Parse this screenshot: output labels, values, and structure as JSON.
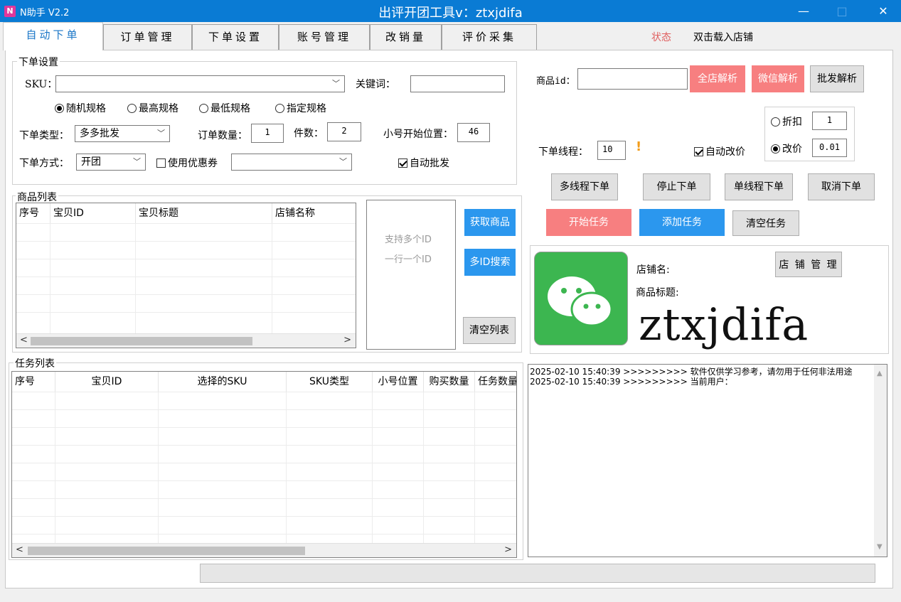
{
  "titlebar": {
    "app_name": "N助手 V2.2",
    "title": "出评开团工具v：ztxjdifa",
    "minimize": "—",
    "maximize": "□",
    "close": "✕"
  },
  "tabs": [
    "自动下单",
    "订单管理",
    "下单设置",
    "账号管理",
    "改销量",
    "评价采集"
  ],
  "status": {
    "label": "状态",
    "load_store": "双击载入店铺"
  },
  "order_settings": {
    "title": "下单设置",
    "sku_label": "SKU：",
    "sku_value": "",
    "keyword_label": "关键词：",
    "keyword_value": "",
    "spec_options": [
      "随机规格",
      "最高规格",
      "最低规格",
      "指定规格"
    ],
    "spec_selected": 0,
    "order_type_label": "下单类型：",
    "order_type_value": "多多批发",
    "order_qty_label": "订单数量：",
    "order_qty_value": "1",
    "pieces_label": "件数：",
    "pieces_value": "2",
    "start_pos_label": "小号开始位置：",
    "start_pos_value": "46",
    "order_mode_label": "下单方式：",
    "order_mode_value": "开团",
    "coupon_label": "使用优惠券",
    "coupon_checked": false,
    "coupon_value": "",
    "auto_batch_label": "自动批发",
    "auto_batch_checked": true
  },
  "product_list": {
    "title": "商品列表",
    "columns": [
      "序号",
      "宝贝ID",
      "宝贝标题",
      "店铺名称"
    ],
    "hint_line1": "支持多个ID",
    "hint_line2": "一行一个ID",
    "btn_fetch": "获取商品",
    "btn_multi_search": "多ID搜索",
    "btn_clear": "清空列表"
  },
  "task_list": {
    "title": "任务列表",
    "columns": [
      "序号",
      "宝贝ID",
      "选择的SKU",
      "SKU类型",
      "小号位置",
      "购买数量",
      "任务数量"
    ]
  },
  "right_panel": {
    "product_id_label": "商品id：",
    "product_id_value": "",
    "btn_shop_parse": "全店解析",
    "btn_wechat_parse": "微信解析",
    "btn_batch_parse": "批发解析",
    "discount_label": "折扣",
    "discount_value": "1",
    "change_price_label": "改价",
    "change_price_value": "0.01",
    "price_mode_selected": 1,
    "thread_label": "下单线程：",
    "thread_value": "10",
    "warn_mark": "!",
    "auto_price_label": "自动改价",
    "auto_price_checked": true,
    "btn_multi_thread": "多线程下单",
    "btn_stop": "停止下单",
    "btn_single_thread": "单线程下单",
    "btn_cancel": "取消下单",
    "btn_start_task": "开始任务",
    "btn_add_task": "添加任务",
    "btn_clear_task": "清空任务",
    "store_name_label": "店铺名:",
    "product_title_label": "商品标题:",
    "btn_store_manage": "店 铺 管 理",
    "watermark": "ztxjdifa"
  },
  "log": {
    "lines": [
      "2025-02-10 15:40:39 >>>>>>>>> 软件仅供学习参考，请勿用于任何非法用途",
      "2025-02-10 15:40:39 >>>>>>>>> 当前用户："
    ]
  },
  "colors": {
    "titlebar": "#0a7bd4",
    "accent_blue": "#2b97ee",
    "accent_red": "#f77f80",
    "wechat_green": "#3cb650"
  }
}
